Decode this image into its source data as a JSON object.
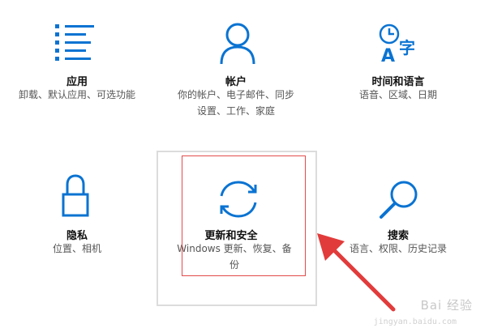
{
  "accent_color": "#0a73d2",
  "tiles": [
    {
      "icon": "apps-list-icon",
      "title": "应用",
      "desc": [
        "卸载、默认应用、可选功能"
      ]
    },
    {
      "icon": "person-icon",
      "title": "帐户",
      "desc": [
        "你的帐户、电子邮件、同步",
        "设置、工作、家庭"
      ]
    },
    {
      "icon": "time-language-icon",
      "title": "时间和语言",
      "desc": [
        "语音、区域、日期"
      ]
    },
    {
      "icon": "lock-icon",
      "title": "隐私",
      "desc": [
        "位置、相机"
      ]
    },
    {
      "icon": "sync-icon",
      "title": "更新和安全",
      "desc": [
        "Windows 更新、恢复、备",
        "份"
      ]
    },
    {
      "icon": "search-icon",
      "title": "搜索",
      "desc": [
        "语言、权限、历史记录"
      ]
    }
  ],
  "watermark": {
    "text": "Bai 经验",
    "url": "jingyan.baidu.com"
  }
}
